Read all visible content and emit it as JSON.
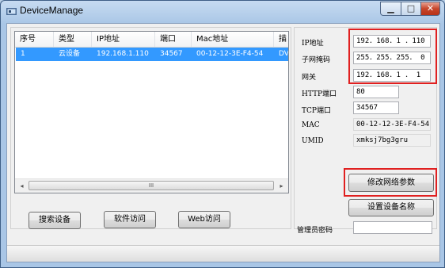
{
  "window": {
    "title": "DeviceManage",
    "min_glyph": "▁",
    "max_glyph": "□",
    "close_glyph": "✕"
  },
  "device_list": {
    "columns": [
      "序号",
      "类型",
      "IP地址",
      "端口",
      "Mac地址",
      "描"
    ],
    "rows": [
      {
        "index": "1",
        "type": "云设备",
        "ip": "192.168.1.110",
        "port": "34567",
        "mac": "00-12-12-3E-F4-54",
        "desc": "DVR"
      }
    ],
    "scroll_left": "◂",
    "scroll_right": "▸",
    "scroll_thumb": "III"
  },
  "buttons": {
    "search": "搜索设备",
    "software_access": "软件访问",
    "web_access": "Web访问",
    "modify_network": "修改网络参数",
    "set_device_name": "设置设备名称"
  },
  "network": {
    "ip_label": "IP地址",
    "ip": "192．168．1 ．110",
    "mask_label": "子网掩码",
    "mask": "255．255．255． 0",
    "gateway_label": "网关",
    "gateway": "192．168．1 ． 1",
    "http_label": "HTTP端口",
    "http": "80",
    "tcp_label": "TCP端口",
    "tcp": "34567",
    "mac_label": "MAC",
    "mac": "00-12-12-3E-F4-54",
    "umid_label": "UMID",
    "umid": "xmksj7bg3gru",
    "admin_label": "管理员密码",
    "admin_password": ""
  },
  "colors": {
    "highlight": "#e02020",
    "selection": "#3399ff"
  }
}
